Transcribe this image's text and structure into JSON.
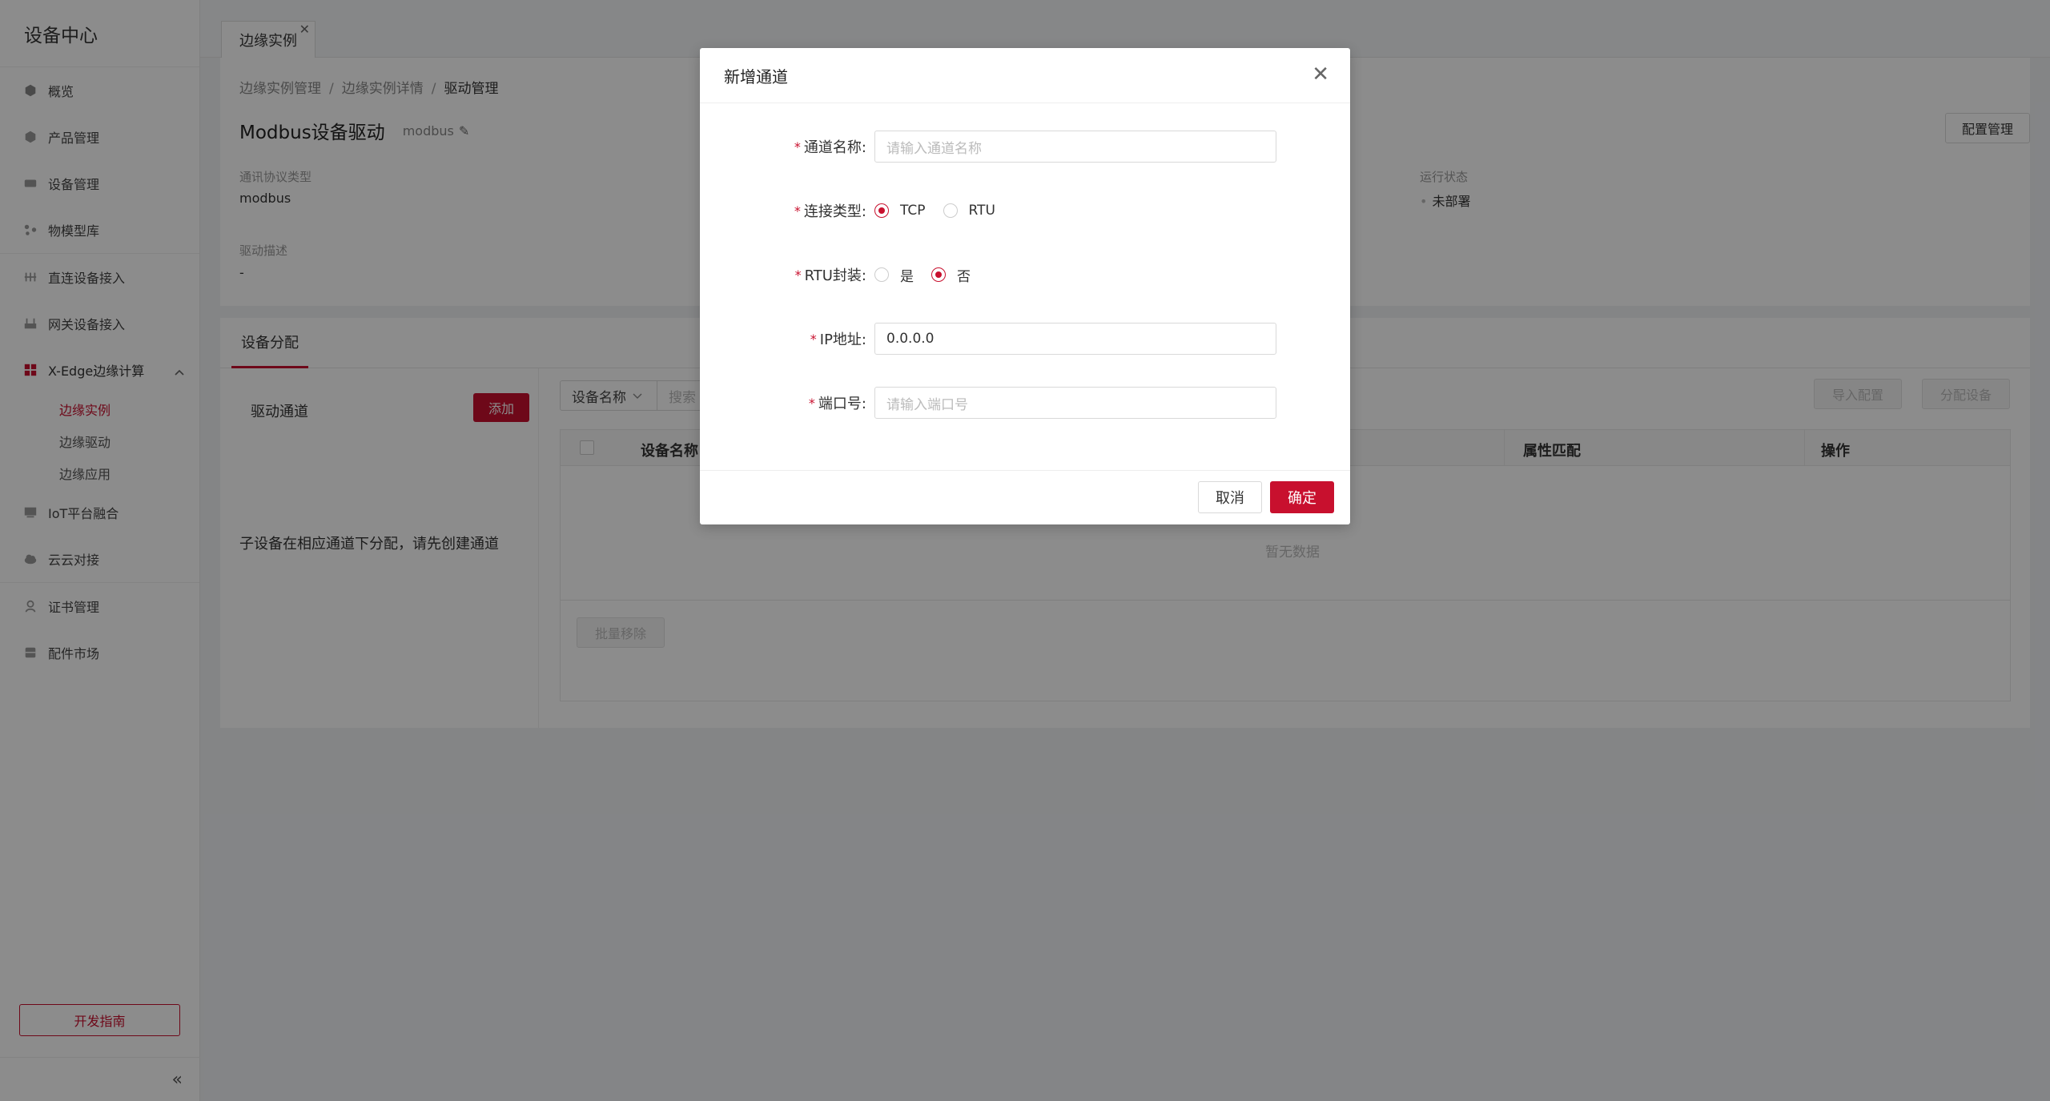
{
  "sidebar": {
    "brand": "设备中心",
    "items": [
      {
        "label": "概览",
        "icon": "cube-icon"
      },
      {
        "label": "产品管理",
        "icon": "box-icon"
      },
      {
        "label": "设备管理",
        "icon": "device-icon"
      },
      {
        "label": "物模型库",
        "icon": "model-icon"
      },
      {
        "label": "直连设备接入",
        "icon": "direct-connect-icon"
      },
      {
        "label": "网关设备接入",
        "icon": "gateway-icon"
      },
      {
        "label": "X-Edge边缘计算",
        "icon": "grid-icon"
      },
      {
        "label": "IoT平台融合",
        "icon": "platform-icon"
      },
      {
        "label": "云云对接",
        "icon": "cloud-icon"
      },
      {
        "label": "证书管理",
        "icon": "certificate-icon"
      },
      {
        "label": "配件市场",
        "icon": "market-icon"
      }
    ],
    "sub_items": [
      "边缘实例",
      "边缘驱动",
      "边缘应用"
    ],
    "dev_guide": "开发指南",
    "collapse": "«"
  },
  "tabs": {
    "active": "边缘实例"
  },
  "breadcrumb": {
    "a": "边缘实例管理",
    "b": "边缘实例详情",
    "c": "驱动管理",
    "sep": "/"
  },
  "header": {
    "title": "Modbus设备驱动",
    "subtitle": "modbus",
    "config_btn": "配置管理"
  },
  "info": {
    "protocol_label": "通讯协议类型",
    "protocol_value": "modbus",
    "status_label": "运行状态",
    "status_value": "未部署",
    "desc_label": "驱动描述",
    "desc_value": "-"
  },
  "assign": {
    "tab": "设备分配",
    "channel_title": "驱动通道",
    "add_btn": "添加",
    "hint": "子设备在相应通道下分配，请先创建通道",
    "filter_select": "设备名称",
    "filter_placeholder": "搜索",
    "import_btn": "导入配置",
    "assign_btn": "分配设备",
    "columns": [
      "设备名称",
      "属性匹配",
      "操作"
    ],
    "empty": "暂无数据",
    "batch_remove": "批量移除"
  },
  "modal": {
    "title": "新增通道",
    "name_label": "通道名称:",
    "name_placeholder": "请输入通道名称",
    "conn_label": "连接类型:",
    "conn_options": [
      "TCP",
      "RTU"
    ],
    "conn_selected": "TCP",
    "rtu_label": "RTU封装:",
    "rtu_options": [
      "是",
      "否"
    ],
    "rtu_selected": "否",
    "ip_label": "IP地址:",
    "ip_value": "0.0.0.0",
    "port_label": "端口号:",
    "port_placeholder": "请输入端口号",
    "required_mark": "*",
    "cancel": "取消",
    "ok": "确定"
  },
  "colors": {
    "accent": "#c8102e"
  }
}
